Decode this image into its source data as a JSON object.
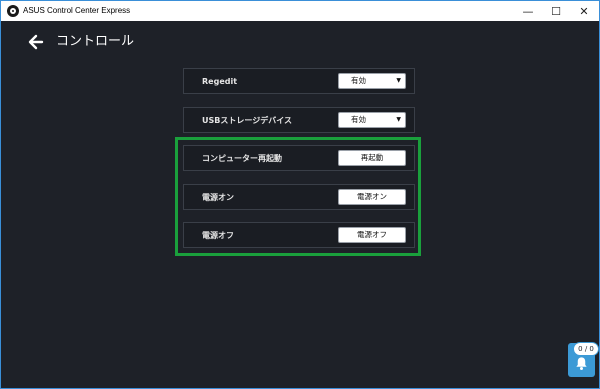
{
  "window": {
    "title": "ASUS Control Center Express",
    "minimize": "—",
    "maximize": "☐",
    "close": "✕"
  },
  "page": {
    "title": "コントロール"
  },
  "rows": [
    {
      "label": "Regedit",
      "control": "select",
      "value": "有効"
    },
    {
      "label": "USBストレージデバイス",
      "control": "select",
      "value": "有効"
    },
    {
      "label": "コンピューター再起動",
      "control": "button",
      "value": "再起動"
    },
    {
      "label": "電源オン",
      "control": "button",
      "value": "電源オン"
    },
    {
      "label": "電源オフ",
      "control": "button",
      "value": "電源オフ"
    }
  ],
  "notifications": {
    "count": "0 / 0"
  },
  "colors": {
    "background": "#1e2128",
    "highlight": "#1aa03c",
    "accent": "#3c9ad6"
  },
  "icons": {
    "back": "arrow-left-icon",
    "notifications": "bell-icon",
    "app": "asus-app-icon"
  }
}
